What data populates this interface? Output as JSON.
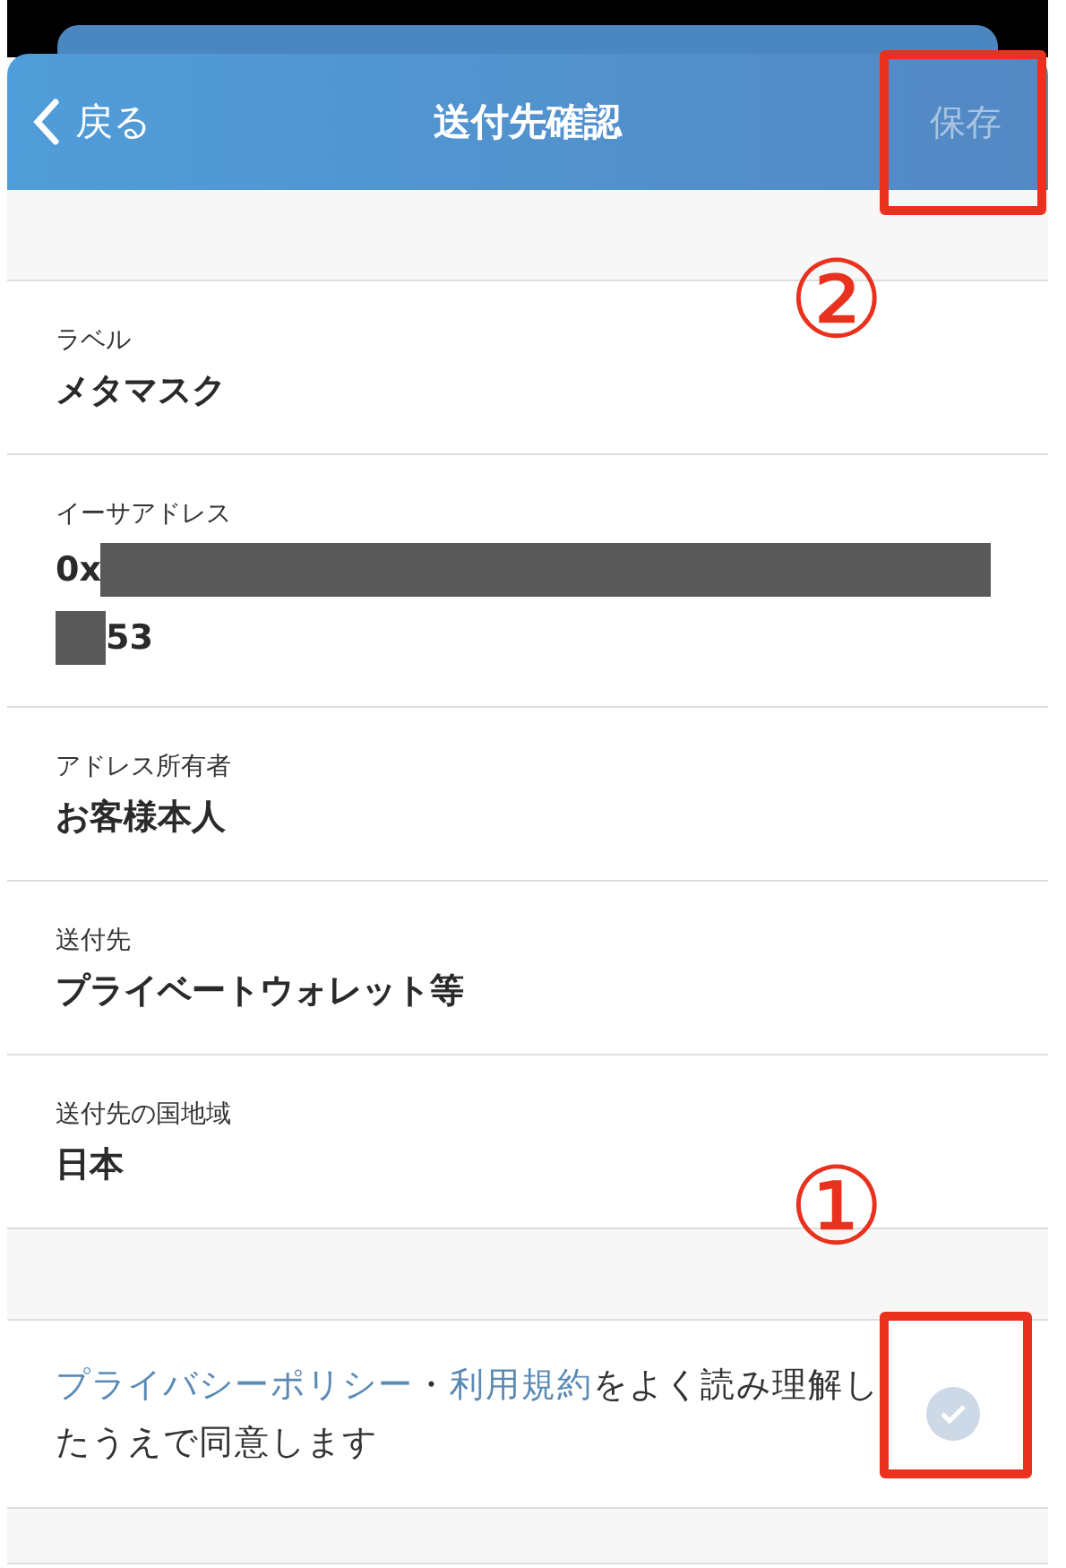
{
  "header": {
    "back_label": "戻る",
    "title": "送付先確認",
    "save_label": "保存",
    "save_disabled": true
  },
  "fields": [
    {
      "kind": "text",
      "label": "ラベル",
      "value": "メタマスク"
    },
    {
      "kind": "redacted",
      "label": "イーサアドレス",
      "value_start": "0x",
      "value_end": "53"
    },
    {
      "kind": "text",
      "label": "アドレス所有者",
      "value": "お客様本人"
    },
    {
      "kind": "text",
      "label": "送付先",
      "value": "プライベートウォレット等"
    },
    {
      "kind": "text",
      "label": "送付先の国地域",
      "value": "日本"
    }
  ],
  "agreement": {
    "link_1": "プライバシーポリシー",
    "separator": "・",
    "link_2": "利用規約",
    "text": "をよく読み理解したうえで同意します",
    "checked": false
  },
  "annotations": [
    {
      "kind": "save",
      "number": "②"
    },
    {
      "kind": "checkbox",
      "number": "①"
    }
  ]
}
